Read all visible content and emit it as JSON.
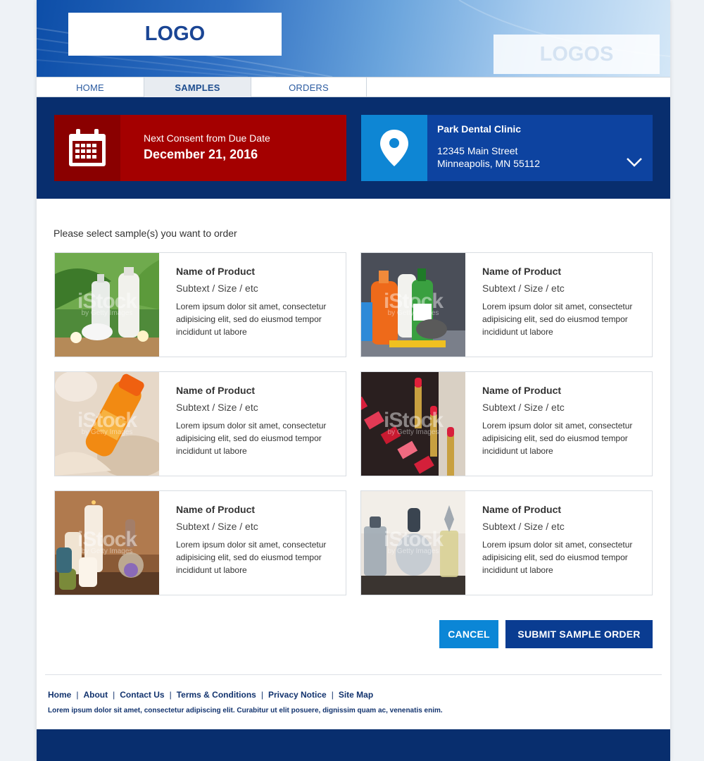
{
  "header": {
    "logo_text": "LOGO",
    "partner_logo_text": "LOGOS"
  },
  "nav": {
    "items": [
      {
        "label": "HOME"
      },
      {
        "label": "SAMPLES",
        "active": true
      },
      {
        "label": "ORDERS"
      }
    ]
  },
  "due_date": {
    "label": "Next Consent from Due Date",
    "date": "December 21, 2016",
    "icon": "calendar-icon",
    "color": "#a40000"
  },
  "clinic": {
    "name": "Park Dental Clinic",
    "street": "12345 Main Street",
    "city_state_zip": "Minneapolis, MN 55112",
    "icon": "map-pin-icon",
    "color": "#0d43a0"
  },
  "instruction": "Please select sample(s) you want to order",
  "products": [
    {
      "name": "Name of Product",
      "subtext": "Subtext / Size / etc",
      "description": "Lorem ipsum dolor sit amet, consectetur adipisicing elit, sed do eiusmod tempor incididunt ut labore",
      "image": "spa-bottles-photo"
    },
    {
      "name": "Name of Product",
      "subtext": "Subtext / Size / etc",
      "description": "Lorem ipsum dolor sit amet, consectetur adipisicing elit, sed do eiusmod tempor incididunt ut labore",
      "image": "cleaning-supplies-photo"
    },
    {
      "name": "Name of Product",
      "subtext": "Subtext / Size / etc",
      "description": "Lorem ipsum dolor sit amet, consectetur adipisicing elit, sed do eiusmod tempor incididunt ut labore",
      "image": "sunscreen-photo"
    },
    {
      "name": "Name of Product",
      "subtext": "Subtext / Size / etc",
      "description": "Lorem ipsum dolor sit amet, consectetur adipisicing elit, sed do eiusmod tempor incididunt ut labore",
      "image": "lipsticks-photo"
    },
    {
      "name": "Name of Product",
      "subtext": "Subtext / Size / etc",
      "description": "Lorem ipsum dolor sit amet, consectetur adipisicing elit, sed do eiusmod tempor incididunt ut labore",
      "image": "candles-photo"
    },
    {
      "name": "Name of Product",
      "subtext": "Subtext / Size / etc",
      "description": "Lorem ipsum dolor sit amet, consectetur adipisicing elit, sed do eiusmod tempor incididunt ut labore",
      "image": "perfume-bottles-photo"
    }
  ],
  "actions": {
    "cancel_label": "CANCEL",
    "submit_label": "SUBMIT SAMPLE ORDER"
  },
  "footer": {
    "links": [
      "Home",
      "About",
      "Contact Us",
      "Terms & Conditions",
      "Privacy Notice",
      "Site Map"
    ],
    "text": "Lorem ipsum dolor sit amet, consectetur adipiscing elit. Curabitur ut elit posuere, dignissim quam ac, venenatis enim."
  },
  "watermark": {
    "text": "iStock",
    "subtext": "by Getty Images"
  },
  "colors": {
    "navy": "#082e6e",
    "accent_blue": "#0b86d6",
    "submit_blue": "#0a3c91"
  }
}
